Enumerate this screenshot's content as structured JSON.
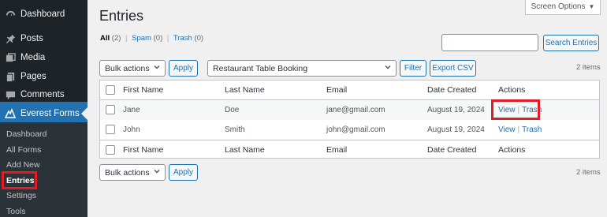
{
  "sidebar": {
    "items": [
      {
        "label": "Dashboard",
        "icon": "dashboard-icon"
      },
      {
        "label": "Posts",
        "icon": "pin-icon"
      },
      {
        "label": "Media",
        "icon": "media-icon"
      },
      {
        "label": "Pages",
        "icon": "pages-icon"
      },
      {
        "label": "Comments",
        "icon": "comments-icon"
      },
      {
        "label": "Everest Forms",
        "icon": "everest-forms-icon"
      }
    ],
    "submenu": [
      "Dashboard",
      "All Forms",
      "Add New",
      "Entries",
      "Settings",
      "Tools"
    ],
    "accent": "#2271b1"
  },
  "page": {
    "title": "Entries",
    "screen_options": "Screen Options"
  },
  "filters": {
    "all_label": "All",
    "all_count": "(2)",
    "spam_label": "Spam",
    "spam_count": "(0)",
    "trash_label": "Trash",
    "trash_count": "(0)",
    "separator": "|"
  },
  "search": {
    "button": "Search Entries",
    "value": ""
  },
  "toolbar": {
    "bulk_actions": "Bulk actions",
    "apply": "Apply",
    "form_select": "Restaurant Table Booking",
    "filter": "Filter",
    "export": "Export CSV",
    "items": "2 items"
  },
  "table": {
    "columns": [
      "First Name",
      "Last Name",
      "Email",
      "Date Created",
      "Actions"
    ],
    "rows": [
      {
        "first": "Jane",
        "last": "Doe",
        "email": "jane@gmail.com",
        "date": "August 19, 2024",
        "view": "View",
        "trash": "Trash"
      },
      {
        "first": "John",
        "last": "Smith",
        "email": "john@gmail.com",
        "date": "August 19, 2024",
        "view": "View",
        "trash": "Trash"
      }
    ]
  },
  "bottom": {
    "bulk_actions": "Bulk actions",
    "apply": "Apply",
    "items": "2 items"
  }
}
